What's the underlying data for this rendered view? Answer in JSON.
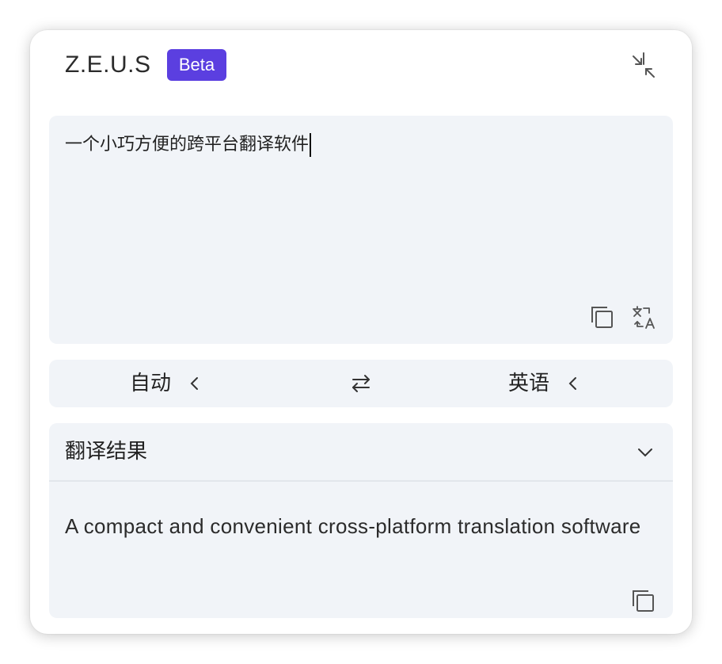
{
  "header": {
    "title": "Z.E.U.S",
    "badge": "Beta",
    "badge_color": "#5b3fe0",
    "collapse_icon": "collapse-arrows-icon"
  },
  "source": {
    "text": "一个小巧方便的跨平台翻译软件",
    "copy_icon": "copy-icon",
    "translate_icon": "translate-icon"
  },
  "languages": {
    "from": "自动",
    "to": "英语",
    "swap_icon": "swap-arrows-icon"
  },
  "result": {
    "title": "翻译结果",
    "text": "A compact and convenient cross-platform translation software",
    "copy_icon": "copy-icon"
  }
}
